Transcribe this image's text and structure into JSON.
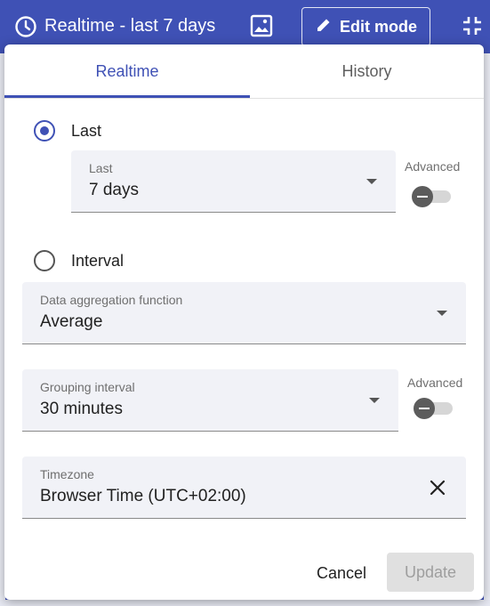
{
  "toolbar": {
    "title": "Realtime - last 7 days",
    "edit_mode_label": "Edit mode"
  },
  "tabs": [
    {
      "label": "Realtime",
      "active": true
    },
    {
      "label": "History",
      "active": false
    }
  ],
  "realtime": {
    "last_option": {
      "label": "Last",
      "selected": true
    },
    "last_field": {
      "label": "Last",
      "value": "7 days"
    },
    "last_advanced": {
      "label": "Advanced",
      "on": false
    },
    "interval_option": {
      "label": "Interval",
      "selected": false
    },
    "aggregation": {
      "label": "Data aggregation function",
      "value": "Average"
    },
    "grouping": {
      "label": "Grouping interval",
      "value": "30 minutes"
    },
    "grouping_advanced": {
      "label": "Advanced",
      "on": false
    },
    "timezone": {
      "label": "Timezone",
      "value": "Browser Time (UTC+02:00)"
    }
  },
  "actions": {
    "cancel_label": "Cancel",
    "update_label": "Update",
    "update_enabled": false
  },
  "colors": {
    "primary": "#3f51b5",
    "field_bg": "#f1f2f7",
    "disabled_bg": "#e0e0e0"
  },
  "icons": [
    "clock-icon",
    "image-icon",
    "pencil-icon",
    "fullscreen-exit-icon",
    "dropdown-caret-icon",
    "close-icon"
  ]
}
